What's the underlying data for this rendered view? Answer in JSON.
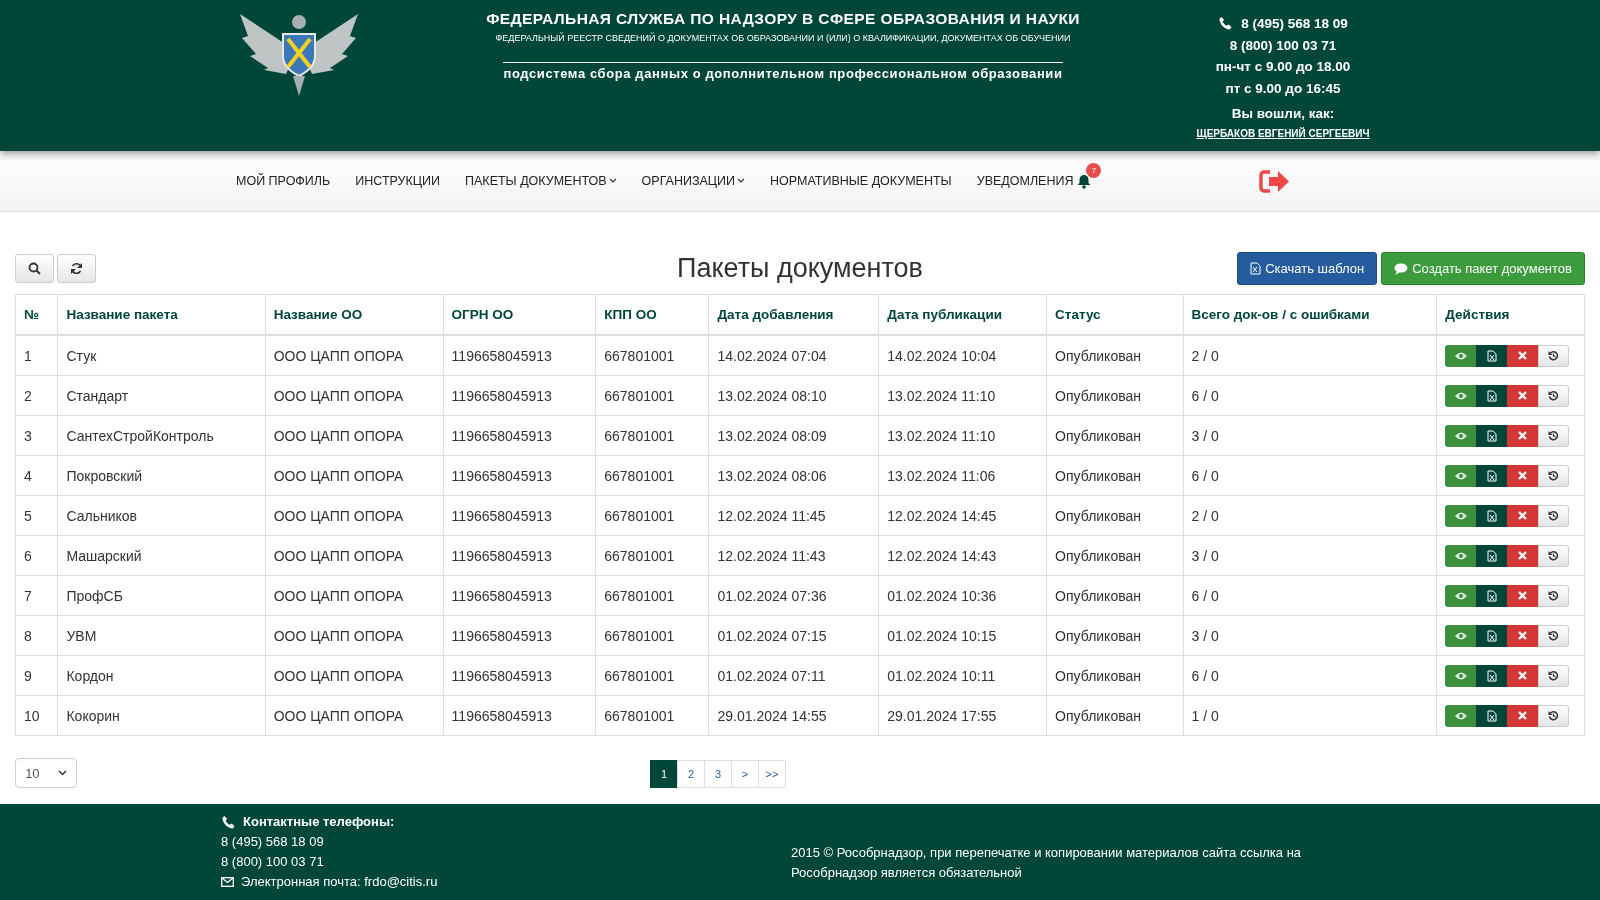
{
  "header": {
    "title": "ФЕДЕРАЛЬНАЯ СЛУЖБА ПО НАДЗОРУ В СФЕРЕ ОБРАЗОВАНИЯ И НАУКИ",
    "subtitle": "ФЕДЕРАЛЬНЫЙ РЕЕСТР СВЕДЕНИЙ О ДОКУМЕНТАХ ОБ ОБРАЗОВАНИИ И (ИЛИ) О КВАЛИФИКАЦИИ, ДОКУМЕНТАХ ОБ ОБУЧЕНИИ",
    "subsystem": "подсистема сбора данных о дополнительном профессиональном образовании",
    "phones": [
      "8 (495) 568 18 09",
      "8 (800) 100 03 71"
    ],
    "hours": [
      "пн-чт с 9.00 до 18.00",
      "пт с 9.00 до 16:45"
    ],
    "logged_in_label": "Вы вошли, как:",
    "user_name": "ЩЕРБАКОВ ЕВГЕНИЙ СЕРГЕЕВИЧ"
  },
  "nav": {
    "items": [
      {
        "label": "МОЙ ПРОФИЛЬ",
        "has_dropdown": false
      },
      {
        "label": "ИНСТРУКЦИИ",
        "has_dropdown": false
      },
      {
        "label": "ПАКЕТЫ ДОКУМЕНТОВ",
        "has_dropdown": true
      },
      {
        "label": "ОРГАНИЗАЦИИ",
        "has_dropdown": true
      },
      {
        "label": "НОРМАТИВНЫЕ ДОКУМЕНТЫ",
        "has_dropdown": false
      },
      {
        "label": "УВЕДОМЛЕНИЯ",
        "has_dropdown": false,
        "badge": "7"
      }
    ]
  },
  "page_title": "Пакеты документов",
  "toolbar_buttons": [
    {
      "kind": "download",
      "label": "Скачать шаблон"
    },
    {
      "kind": "create",
      "label": "Создать пакет документов"
    }
  ],
  "table": {
    "columns": [
      "№",
      "Название пакета",
      "Название ОО",
      "ОГРН ОО",
      "КПП ОО",
      "Дата добавления",
      "Дата публикации",
      "Статус",
      "Всего док-ов / с ошибками",
      "Действия"
    ],
    "rows": [
      [
        "1",
        "Стук",
        "ООО ЦАПП ОПОРА",
        "1196658045913",
        "667801001",
        "14.02.2024 07:04",
        "14.02.2024 10:04",
        "Опубликован",
        "2 / 0"
      ],
      [
        "2",
        "Стандарт",
        "ООО ЦАПП ОПОРА",
        "1196658045913",
        "667801001",
        "13.02.2024 08:10",
        "13.02.2024 11:10",
        "Опубликован",
        "6 / 0"
      ],
      [
        "3",
        "СантехСтройКонтроль",
        "ООО ЦАПП ОПОРА",
        "1196658045913",
        "667801001",
        "13.02.2024 08:09",
        "13.02.2024 11:10",
        "Опубликован",
        "3 / 0"
      ],
      [
        "4",
        "Покровский",
        "ООО ЦАПП ОПОРА",
        "1196658045913",
        "667801001",
        "13.02.2024 08:06",
        "13.02.2024 11:06",
        "Опубликован",
        "6 / 0"
      ],
      [
        "5",
        "Сальников",
        "ООО ЦАПП ОПОРА",
        "1196658045913",
        "667801001",
        "12.02.2024 11:45",
        "12.02.2024 14:45",
        "Опубликован",
        "2 / 0"
      ],
      [
        "6",
        "Машарский",
        "ООО ЦАПП ОПОРА",
        "1196658045913",
        "667801001",
        "12.02.2024 11:43",
        "12.02.2024 14:43",
        "Опубликован",
        "3 / 0"
      ],
      [
        "7",
        "ПрофСБ",
        "ООО ЦАПП ОПОРА",
        "1196658045913",
        "667801001",
        "01.02.2024 07:36",
        "01.02.2024 10:36",
        "Опубликован",
        "6 / 0"
      ],
      [
        "8",
        "УВМ",
        "ООО ЦАПП ОПОРА",
        "1196658045913",
        "667801001",
        "01.02.2024 07:15",
        "01.02.2024 10:15",
        "Опубликован",
        "3 / 0"
      ],
      [
        "9",
        "Кордон",
        "ООО ЦАПП ОПОРА",
        "1196658045913",
        "667801001",
        "01.02.2024 07:11",
        "01.02.2024 10:11",
        "Опубликован",
        "6 / 0"
      ],
      [
        "10",
        "Кокорин",
        "ООО ЦАПП ОПОРА",
        "1196658045913",
        "667801001",
        "29.01.2024 14:55",
        "29.01.2024 17:55",
        "Опубликован",
        "1 / 0"
      ]
    ]
  },
  "page_size": "10",
  "pagination": [
    {
      "label": "1",
      "selected": true
    },
    {
      "label": "2",
      "selected": false
    },
    {
      "label": "3",
      "selected": false
    },
    {
      "label": ">",
      "selected": false
    },
    {
      "label": ">>",
      "selected": false
    }
  ],
  "footer": {
    "contacts_label": "Контактные телефоны:",
    "phones": [
      "8 (495) 568 18 09",
      "8 (800) 100 03 71"
    ],
    "email": "Электронная почта: frdo@citis.ru",
    "copyright": "2015 © Рособрнадзор, при перепечатке и копировании материалов сайта ссылка на Рособрнадзор является обязательной"
  }
}
